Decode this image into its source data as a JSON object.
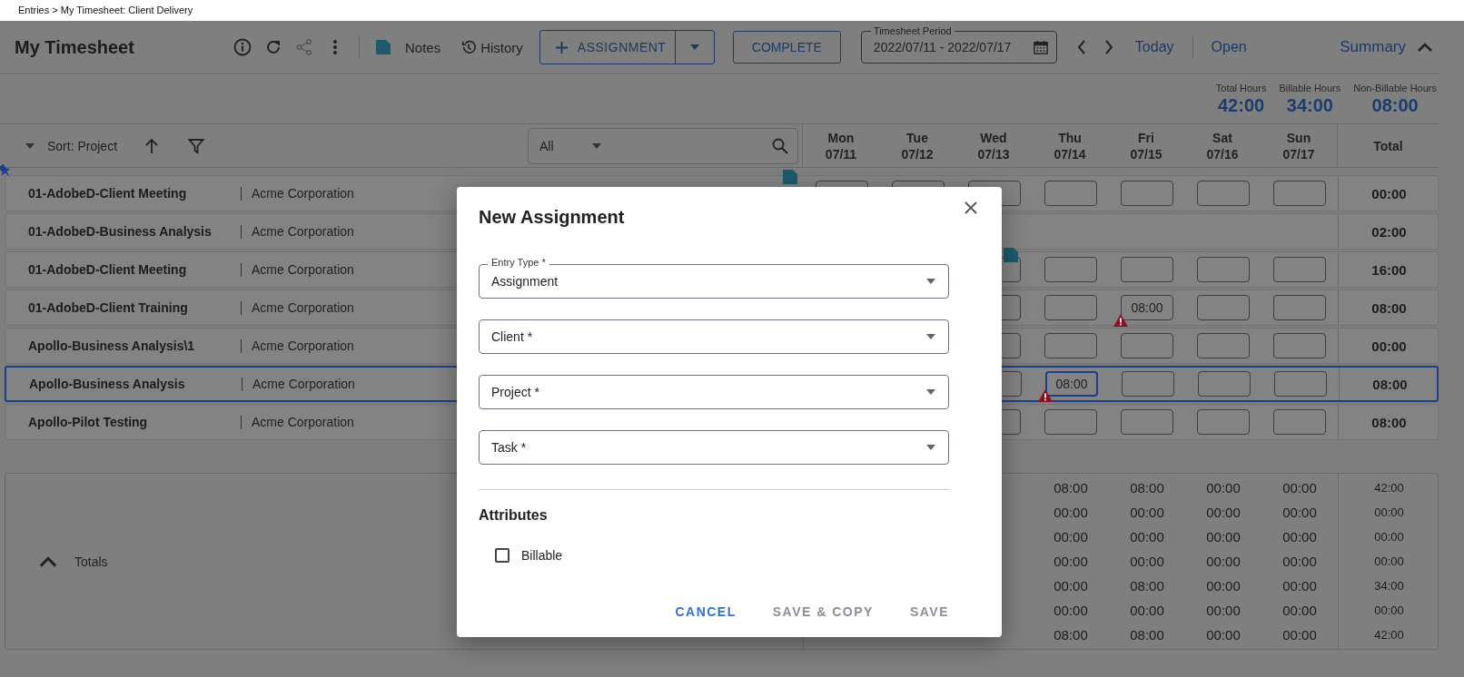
{
  "breadcrumb": "Entries > My Timesheet: Client Delivery",
  "header": {
    "title": "My Timesheet",
    "notes_label": "Notes",
    "history_label": "History",
    "assignment_button": "ASSIGNMENT",
    "complete_button": "COMPLETE",
    "period": {
      "label": "Timesheet Period",
      "value": "2022/07/11 - 2022/07/17"
    },
    "today_link": "Today",
    "status": "Open",
    "summary_toggle": {
      "label": "Summary",
      "expanded": true
    }
  },
  "summary": [
    {
      "label": "Total Hours",
      "value": "42:00"
    },
    {
      "label": "Billable Hours",
      "value": "34:00"
    },
    {
      "label": "Non-Billable Hours",
      "value": "08:00"
    }
  ],
  "toolbar": {
    "sort_label": "Sort: Project",
    "filter": {
      "value": "All"
    }
  },
  "days": [
    {
      "day": "Mon",
      "date": "07/11"
    },
    {
      "day": "Tue",
      "date": "07/12"
    },
    {
      "day": "Wed",
      "date": "07/13"
    },
    {
      "day": "Thu",
      "date": "07/14"
    },
    {
      "day": "Fri",
      "date": "07/15"
    },
    {
      "day": "Sat",
      "date": "07/16"
    },
    {
      "day": "Sun",
      "date": "07/17"
    }
  ],
  "total_heading": "Total",
  "rows": [
    {
      "name": "01-AdobeD-Client Meeting",
      "client": "Acme Corporation",
      "total": "00:00",
      "selected": false,
      "pinned": true,
      "note": true,
      "day_note": false,
      "entries": [
        {
          "selected": false,
          "warning": false
        },
        {
          "selected": false,
          "warning": false
        },
        {
          "selected": false,
          "warning": false
        },
        {
          "selected": false,
          "warning": false
        }
      ]
    },
    {
      "name": "01-AdobeD-Business Analysis",
      "client": "Acme Corporation",
      "total": "02:00",
      "selected": false,
      "pinned": false,
      "note": false,
      "day_note": false
    },
    {
      "name": "01-AdobeD-Client Meeting",
      "client": "Acme Corporation",
      "total": "16:00",
      "selected": false,
      "pinned": false,
      "note": false,
      "day_note": true,
      "entries": [
        {
          "selected": false,
          "warning": false
        },
        {
          "selected": false,
          "warning": false
        },
        {
          "selected": false,
          "warning": false
        },
        {
          "selected": false,
          "warning": false
        }
      ]
    },
    {
      "name": "01-AdobeD-Client Training",
      "client": "Acme Corporation",
      "total": "08:00",
      "selected": false,
      "pinned": false,
      "note": false,
      "day_note": false,
      "entries": [
        {
          "selected": false,
          "warning": false
        },
        {
          "value": "08:00",
          "selected": false,
          "warning": true
        },
        {
          "selected": false,
          "warning": false
        },
        {
          "selected": false,
          "warning": false
        }
      ]
    },
    {
      "name": "Apollo-Business Analysis\\1",
      "client": "Acme Corporation",
      "total": "00:00",
      "selected": false,
      "pinned": false,
      "note": false,
      "day_note": false,
      "entries": [
        {
          "selected": false,
          "warning": false
        },
        {
          "selected": false,
          "warning": false
        },
        {
          "selected": false,
          "warning": false
        },
        {
          "selected": false,
          "warning": false
        }
      ]
    },
    {
      "name": "Apollo-Business Analysis",
      "client": "Acme Corporation",
      "total": "08:00",
      "selected": true,
      "pinned": false,
      "note": false,
      "day_note": false,
      "entries": [
        {
          "value": "08:00",
          "selected": true,
          "warning": true
        },
        {
          "selected": false,
          "warning": false
        },
        {
          "selected": false,
          "warning": false
        },
        {
          "selected": false,
          "warning": false
        }
      ]
    },
    {
      "name": "Apollo-Pilot Testing",
      "client": "Acme Corporation",
      "total": "08:00",
      "selected": false,
      "pinned": false,
      "note": false,
      "day_note": false,
      "entries": [
        {
          "selected": false,
          "warning": false
        },
        {
          "selected": false,
          "warning": false
        },
        {
          "selected": false,
          "warning": false
        },
        {
          "selected": false,
          "warning": false
        }
      ]
    }
  ],
  "totals": {
    "label": "Totals",
    "expanded": true,
    "lines": [
      {
        "days": [
          "08:00",
          "08:00",
          "00:00",
          "00:00"
        ],
        "total": "42:00"
      },
      {
        "days": [
          "00:00",
          "00:00",
          "00:00",
          "00:00"
        ],
        "total": "00:00"
      },
      {
        "days": [
          "00:00",
          "00:00",
          "00:00",
          "00:00"
        ],
        "total": "00:00"
      },
      {
        "days": [
          "00:00",
          "00:00",
          "00:00",
          "00:00"
        ],
        "total": "00:00"
      },
      {
        "days": [
          "00:00",
          "08:00",
          "00:00",
          "00:00"
        ],
        "total": "34:00"
      },
      {
        "days": [
          "00:00",
          "00:00",
          "00:00",
          "00:00"
        ],
        "total": "00:00"
      },
      {
        "days": [
          "08:00",
          "08:00",
          "00:00",
          "00:00"
        ],
        "total": "42:00"
      }
    ]
  },
  "dialog": {
    "title": "New Assignment",
    "fields": [
      {
        "label": "Entry Type *",
        "value": "Assignment"
      },
      {
        "label": "Client *"
      },
      {
        "label": "Project *"
      },
      {
        "label": "Task *"
      }
    ],
    "section": "Attributes",
    "checkboxes": [
      {
        "label": "Billable",
        "checked": false
      }
    ],
    "buttons": [
      {
        "label": "CANCEL",
        "kind": "primary"
      },
      {
        "label": "SAVE & COPY",
        "kind": "disabled"
      },
      {
        "label": "SAVE",
        "kind": "disabled"
      }
    ]
  }
}
